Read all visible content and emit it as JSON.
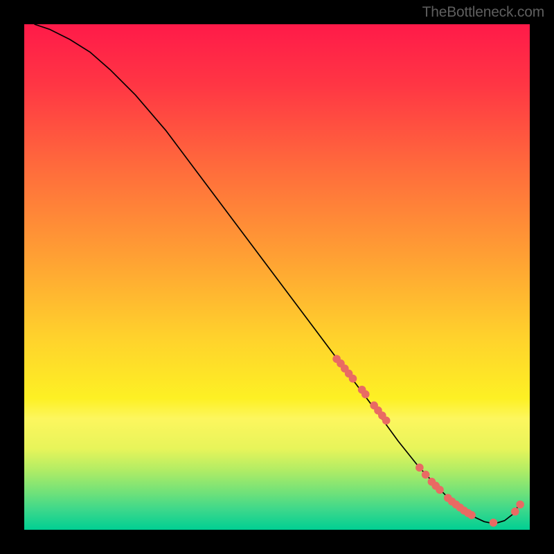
{
  "watermark": "TheBottleneck.com",
  "chart_data": {
    "type": "line",
    "title": "",
    "xlabel": "",
    "ylabel": "",
    "xlim": [
      0,
      100
    ],
    "ylim": [
      0,
      100
    ],
    "grid": false,
    "legend": false,
    "background_gradient_stops": [
      {
        "offset": 0.0,
        "color": "#ff1a49"
      },
      {
        "offset": 0.12,
        "color": "#ff3644"
      },
      {
        "offset": 0.28,
        "color": "#ff6a3c"
      },
      {
        "offset": 0.45,
        "color": "#ff9d34"
      },
      {
        "offset": 0.62,
        "color": "#ffd22c"
      },
      {
        "offset": 0.74,
        "color": "#fdf024"
      },
      {
        "offset": 0.78,
        "color": "#fdf65e"
      },
      {
        "offset": 0.84,
        "color": "#e7f45a"
      },
      {
        "offset": 0.88,
        "color": "#b4ed64"
      },
      {
        "offset": 0.92,
        "color": "#7ae376"
      },
      {
        "offset": 0.96,
        "color": "#3dd88b"
      },
      {
        "offset": 1.0,
        "color": "#00cf93"
      }
    ],
    "series": [
      {
        "name": "curve",
        "style": "line",
        "color": "#000000",
        "width": 1.7,
        "x": [
          2,
          5,
          9,
          13,
          17,
          22,
          28,
          34,
          40,
          46,
          52,
          58,
          64,
          70,
          74,
          78,
          82,
          85,
          88,
          91,
          93,
          95,
          96.8,
          98
        ],
        "y": [
          100,
          99,
          97,
          94.5,
          91,
          86,
          79,
          71,
          63,
          55,
          47,
          39,
          31,
          23,
          17.5,
          12.5,
          8.2,
          5.2,
          3.0,
          1.6,
          1.2,
          1.8,
          3.2,
          5.2
        ]
      },
      {
        "name": "dots",
        "style": "scatter",
        "color": "#e96a63",
        "radius": 5.8,
        "x": [
          61.8,
          62.6,
          63.4,
          64.2,
          65.0,
          66.8,
          67.5,
          69.2,
          70.0,
          70.8,
          71.6,
          78.2,
          79.4,
          80.6,
          81.4,
          82.2,
          83.8,
          84.6,
          85.4,
          86.2,
          87.0,
          87.8,
          88.5,
          92.8,
          97.1,
          98.1
        ],
        "y": [
          33.8,
          32.9,
          31.9,
          30.9,
          29.9,
          27.7,
          26.8,
          24.6,
          23.6,
          22.6,
          21.6,
          12.3,
          10.9,
          9.5,
          8.7,
          7.9,
          6.3,
          5.6,
          5.0,
          4.4,
          3.8,
          3.3,
          2.9,
          1.4,
          3.6,
          5.0
        ]
      }
    ]
  }
}
